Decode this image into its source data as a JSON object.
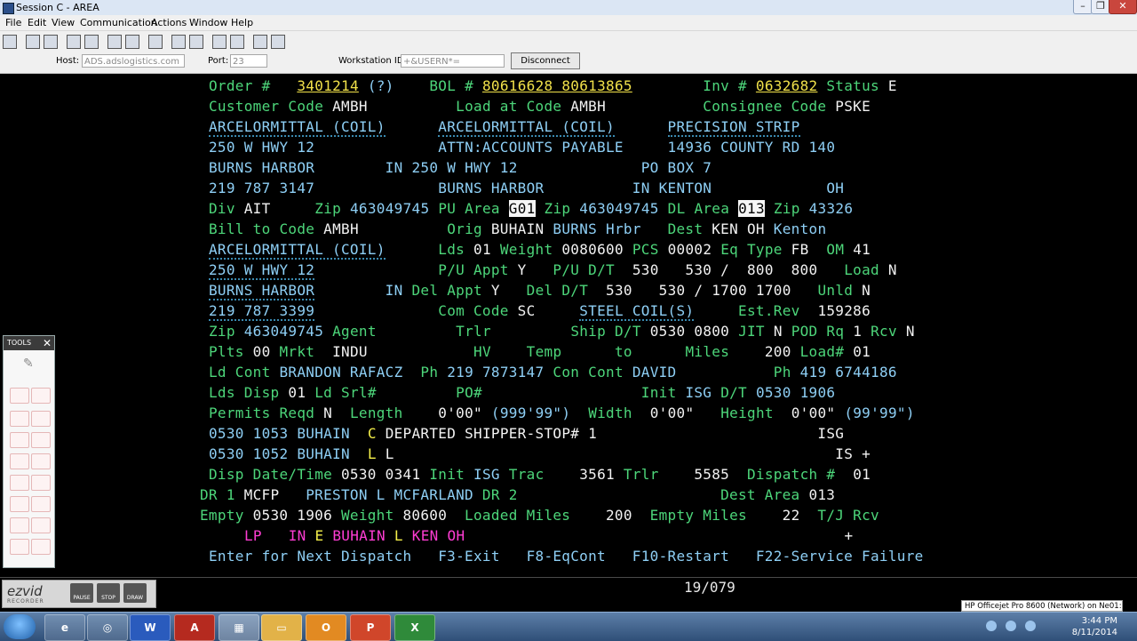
{
  "window": {
    "title": "Session C - AREA"
  },
  "menu": [
    "File",
    "Edit",
    "View",
    "Communication",
    "Actions",
    "Window",
    "Help"
  ],
  "connection": {
    "host_label": "Host:",
    "host_value": "ADS.adslogistics.com",
    "port_label": "Port:",
    "port_value": "23",
    "ws_label": "Workstation ID:",
    "ws_value": "+&USERN*=",
    "disconnect": "Disconnect"
  },
  "tools": {
    "title": "TOOLS"
  },
  "status": {
    "position": "19/079",
    "printer": "HP Officejet Pro 8600 (Network) on Ne01:"
  },
  "ezvid": {
    "logo": "ezvid",
    "sub": "RECORDER",
    "pause": "PAUSE",
    "stop": "STOP",
    "draw": "DRAW"
  },
  "taskbar": {
    "time": "3:44 PM",
    "date": "8/11/2014"
  },
  "screen": {
    "order_label": "Order #",
    "order_no": "3401214",
    "order_q": "(?)",
    "bol_label": "BOL #",
    "bol_no": "80616628 80613865",
    "inv_label": "Inv #",
    "inv_no": "0632682",
    "status_label": "Status",
    "status_val": "E",
    "cust_label": "Customer Code",
    "cust_code": "AMBH",
    "loadat_label": "Load at Code",
    "loadat_code": "AMBH",
    "consig_label": "Consignee Code",
    "consig_code": "PSKE",
    "r3a": "ARCELORMITTAL (COIL)",
    "r3b": "ARCELORMITTAL (COIL)",
    "r3c": "PRECISION STRIP",
    "r4a": "250 W HWY 12",
    "r4b": "ATTN:ACCOUNTS PAYABLE",
    "r4c": "14936 COUNTY RD 140",
    "r5a": "BURNS HARBOR",
    "r5st": "IN",
    "r5b": "250 W HWY 12",
    "r5c": "PO BOX 7",
    "r6a": "219 787 3147",
    "r6b": "BURNS HARBOR",
    "r6st": "IN",
    "r6c": "KENTON",
    "r6st2": "OH",
    "div_label": "Div",
    "div_val": "AIT",
    "zip1_label": "Zip",
    "zip1": "463049745",
    "puarea_label": "PU Area",
    "puarea": "G01",
    "zip2_label": "Zip",
    "zip2": "463049745",
    "dlarea_label": "DL Area",
    "dlarea": "013",
    "zip3_label": "Zip",
    "zip3": "43326",
    "bill_label": "Bill to Code",
    "bill_code": "AMBH",
    "orig_label": "Orig",
    "orig_val": "BUHAIN",
    "orig_name": "BURNS Hrbr",
    "dest_label": "Dest",
    "dest_val": "KEN OH",
    "dest_name": "Kenton",
    "r9a": "ARCELORMITTAL (COIL)",
    "lds_label": "Lds",
    "lds_val": "01",
    "wt_label": "Weight",
    "wt_val": "0080600",
    "pcs_label": "PCS",
    "pcs_val": "00002",
    "eq_label": "Eq Type",
    "eq_val": "FB",
    "om_label": "OM",
    "om_val": "41",
    "r10a": "250 W HWY 12",
    "puappt_label": "P/U Appt",
    "puappt_val": "Y",
    "pudt_label": "P/U D/T",
    "pudt_val": "530   530 /  800  800",
    "load_label": "Load",
    "load_val": "N",
    "r11a": "BURNS HARBOR",
    "r11st": "IN",
    "delappt_label": "Del Appt",
    "delappt_val": "Y",
    "deldt_label": "Del D/T",
    "deldt_val": "530   530 / 1700 1700",
    "unld_label": "Unld",
    "unld_val": "N",
    "r12a": "219 787 3399",
    "com_label": "Com Code",
    "com_val": "SC",
    "com_desc": "STEEL COIL(S)",
    "estrev_label": "Est.Rev",
    "estrev_val": "159286",
    "zip4_label": "Zip",
    "zip4": "463049745",
    "agent_label": "Agent",
    "trlr_label": "Trlr",
    "shipdt_label": "Ship D/T",
    "shipdt_val": "0530 0800",
    "jit_label": "JIT",
    "jit_val": "N",
    "podrq_label": "POD Rq",
    "podrq_val": "1",
    "rcv_label": "Rcv",
    "rcv_val": "N",
    "plts_label": "Plts",
    "plts_val": "00",
    "mrkt_label": "Mrkt",
    "mrkt_val": "INDU",
    "hv_label": "HV",
    "temp_label": "Temp",
    "to_label": "to",
    "miles_label": "Miles",
    "miles_val": "200",
    "loadno_label": "Load#",
    "loadno_val": "01",
    "ldcont_label": "Ld Cont",
    "ldcont_val": "BRANDON RAFACZ",
    "ph1_label": "Ph",
    "ph1_val": "219 7873147",
    "concont_label": "Con Cont",
    "concont_val": "DAVID",
    "ph2_label": "Ph",
    "ph2_val": "419 6744186",
    "ldsdisp_label": "Lds Disp",
    "ldsdisp_val": "01",
    "ldsrl_label": "Ld Srl#",
    "po_label": "PO#",
    "init_label": "Init",
    "init_val": "ISG",
    "dt_label": "D/T",
    "dt_val": "0530 1906",
    "permits_label": "Permits Reqd",
    "permits_val": "N",
    "length_label": "Length",
    "length_val": "0'00\"",
    "length_fmt": "(999'99\")",
    "width_label": "Width",
    "width_val": "0'00\"",
    "height_label": "Height",
    "height_val": "0'00\"",
    "height_fmt": "(99'99\")",
    "ev1_a": "0530 1053 BUHAIN",
    "ev1_b": "C",
    "ev1_c": "DEPARTED SHIPPER-STOP# 1",
    "ev1_d": "ISG",
    "ev2_a": "0530 1052 BUHAIN",
    "ev2_b": "L",
    "ev2_c": "L",
    "ev2_d": "IS",
    "ev2_e": "+",
    "dispdt_label": "Disp Date/Time",
    "dispdt_val": "0530 0341",
    "init2_label": "Init",
    "init2_val": "ISG",
    "trac_label": "Trac",
    "trac_val": "3561",
    "trlr2_label": "Trlr",
    "trlr2_val": "5585",
    "dispno_label": "Dispatch #",
    "dispno_val": "01",
    "dr1_label": "DR 1",
    "dr1_code": "MCFP",
    "dr1_name": "PRESTON L MCFARLAND",
    "dr2_label": "DR 2",
    "destarea_label": "Dest Area",
    "destarea_val": "013",
    "empty_label": "Empty",
    "empty_val": "0530 1906",
    "wt2_label": "Weight",
    "wt2_val": "80600",
    "lmiles_label": "Loaded Miles",
    "lmiles_val": "200",
    "emiles_label": "Empty Miles",
    "emiles_val": "22",
    "tj_label": "T/J Rcv",
    "lp_a": "LP",
    "lp_b": "IN",
    "lp_c": "E",
    "lp_d": "BUHAIN",
    "lp_e": "L",
    "lp_f": "KEN OH",
    "lp_plus": "+",
    "fkeys": "Enter for Next Dispatch   F3-Exit   F8-EqCont   F10-Restart   F22-Service Failure"
  },
  "colors": {
    "label": "#4dd67a",
    "data": "#8ecff5",
    "value": "#f2f2f2",
    "link": "#f1e14a",
    "magenta": "#ff3dd4"
  }
}
